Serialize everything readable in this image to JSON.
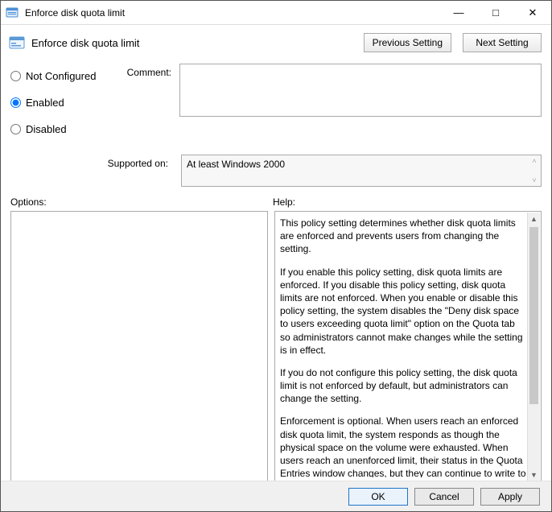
{
  "window": {
    "title": "Enforce disk quota limit"
  },
  "header": {
    "title": "Enforce disk quota limit",
    "prev_btn": "Previous Setting",
    "next_btn": "Next Setting"
  },
  "radios": {
    "not_configured": "Not Configured",
    "enabled": "Enabled",
    "disabled": "Disabled",
    "selected": "enabled"
  },
  "labels": {
    "comment": "Comment:",
    "supported_on": "Supported on:",
    "options": "Options:",
    "help": "Help:"
  },
  "comment_value": "",
  "supported_on_value": "At least Windows 2000",
  "help_paragraphs": {
    "p1": "This policy setting determines whether disk quota limits are enforced and prevents users from changing the setting.",
    "p2": "If you enable this policy setting, disk quota limits are enforced. If you disable this policy setting, disk quota limits are not enforced. When you enable or disable this policy setting, the system disables the \"Deny disk space to users exceeding quota limit\" option on the Quota tab so administrators cannot make changes while the setting is in effect.",
    "p3": "If you do not configure this policy setting, the disk quota limit is not enforced by default, but administrators can change the setting.",
    "p4": "Enforcement is optional. When users reach an enforced disk quota limit, the system responds as though the physical space on the volume were exhausted. When users reach an unenforced limit, their status in the Quota Entries window changes, but they can continue to write to the volume as long as physical space is available."
  },
  "footer": {
    "ok": "OK",
    "cancel": "Cancel",
    "apply": "Apply"
  }
}
